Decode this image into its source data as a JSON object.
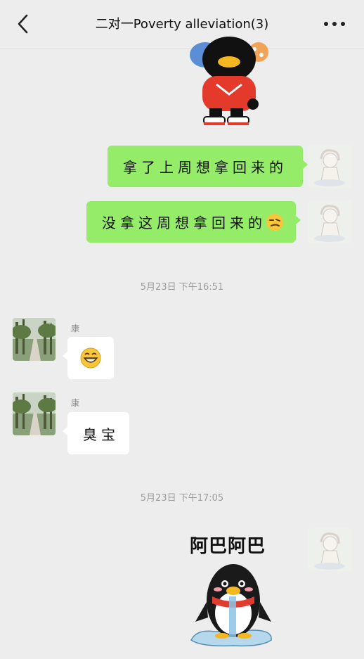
{
  "header": {
    "title": "二对一Poverty  alleviation(3)",
    "back_icon": "chevron-left-icon",
    "more_icon": "more-horizontal-icon"
  },
  "messages": [
    {
      "from": "self",
      "type": "sticker",
      "sticker": "penguin-red-hoodie-sticker"
    },
    {
      "from": "self",
      "type": "text",
      "text": "拿了上周想拿回来的"
    },
    {
      "from": "self",
      "type": "text",
      "text": "没拿这周想拿回来的",
      "emoji": "smirk-face-emoji"
    },
    {
      "type": "timestamp",
      "text": "5月23日 下午16:51"
    },
    {
      "from": "other",
      "sender": "康",
      "type": "emoji",
      "emoji": "grin-face-emoji"
    },
    {
      "from": "other",
      "sender": "康",
      "type": "text",
      "text": "臭宝"
    },
    {
      "type": "timestamp",
      "text": "5月23日 下午17:05"
    },
    {
      "from": "self",
      "type": "sticker",
      "sticker": "penguin-drooling-sticker",
      "caption": "阿巴阿巴"
    }
  ],
  "colors": {
    "background": "#ededed",
    "self_bubble": "#95ec69",
    "other_bubble": "#ffffff"
  }
}
